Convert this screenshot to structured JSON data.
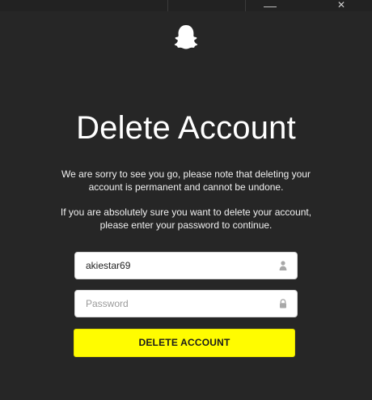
{
  "logo": {
    "icon": "ghost-icon",
    "color": "#ffffff"
  },
  "page": {
    "title": "Delete Account",
    "paragraph_1": "We are sorry to see you go, please note that deleting your account is permanent and cannot be undone.",
    "paragraph_2": "If you are absolutely sure you want to delete your account, please enter your password to continue."
  },
  "form": {
    "username": {
      "value": "akiestar69",
      "icon": "user-icon"
    },
    "password": {
      "value": "",
      "placeholder": "Password",
      "icon": "lock-icon"
    },
    "submit_label": "DELETE ACCOUNT"
  },
  "colors": {
    "background": "#262626",
    "button": "#fffc00",
    "button_text": "#1b1b1b"
  }
}
